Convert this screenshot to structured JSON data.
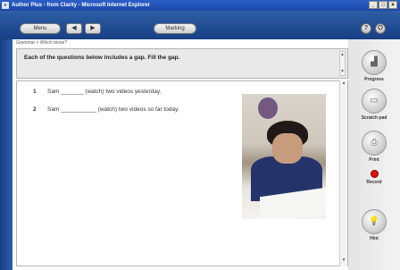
{
  "window": {
    "title": "Author Plus - from Clarity - Microsoft Internet Explorer",
    "controls": [
      "_",
      "□",
      "×"
    ]
  },
  "toolbar": {
    "menu_label": "Menu",
    "marking_label": "Marking",
    "back_glyph": "◀",
    "forward_glyph": "▶",
    "help_glyph": "?",
    "exit_glyph": "⏻"
  },
  "breadcrumb": "Grammar > Which tense?",
  "instructions": "Each of the questions below includes a gap. Fill the gap.",
  "questions": [
    {
      "number": "1",
      "text": "Sam _______ (watch) two videos yesterday."
    },
    {
      "number": "2",
      "text": "Sam ___________ (watch) two videos so far today."
    }
  ],
  "sidebar": {
    "progress": "Progress",
    "scratch_pad": "Scratch pad",
    "print": "Print",
    "record": "Record",
    "hint": "Hint"
  },
  "colors": {
    "toolbar": "#1f4b96",
    "record": "#dd1111"
  }
}
